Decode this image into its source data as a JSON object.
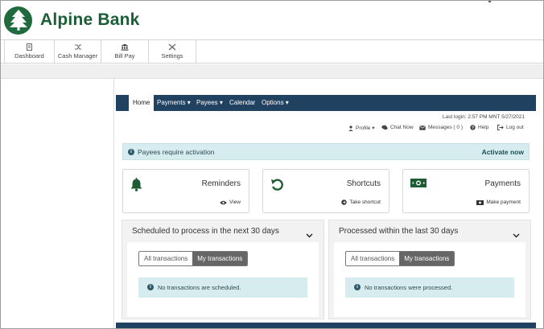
{
  "brand": {
    "name": "Alpine Bank"
  },
  "top_nav": [
    {
      "label": "Dashboard",
      "icon": "doc-icon"
    },
    {
      "label": "Cash Manager",
      "icon": "shuffle-icon"
    },
    {
      "label": "Bill Pay",
      "icon": "bank-icon"
    },
    {
      "label": "Settings",
      "icon": "tools-icon"
    }
  ],
  "menu": {
    "home": "Home",
    "payments": "Payments ▾",
    "payees": "Payees ▾",
    "calendar": "Calendar",
    "options": "Options ▾"
  },
  "last_login": "Last login: 2:57 PM MNT 5/27/2021",
  "utility": {
    "profile": "Profile ▾",
    "chat": "Chat Now",
    "messages": "Messages ( 0 )",
    "help": "Help",
    "logout": "Log out"
  },
  "alert": {
    "text": "Payees require activation",
    "action": "Activate now"
  },
  "cards": [
    {
      "title": "Reminders",
      "action": "View"
    },
    {
      "title": "Shortcuts",
      "action": "Take shortcut"
    },
    {
      "title": "Payments",
      "action": "Make payment"
    }
  ],
  "panels": [
    {
      "title": "Scheduled to process in the next 30 days",
      "seg_all": "All transactions",
      "seg_mine": "My transactions",
      "empty": "No transactions are scheduled."
    },
    {
      "title": "Processed within the last 30 days",
      "seg_all": "All transactions",
      "seg_mine": "My transactions",
      "empty": "No transactions were processed."
    }
  ],
  "colors": {
    "brand_green": "#1b5e36",
    "nav_blue": "#20415f",
    "info_bg": "#d7ecef",
    "icon_green": "#1d5c34"
  }
}
